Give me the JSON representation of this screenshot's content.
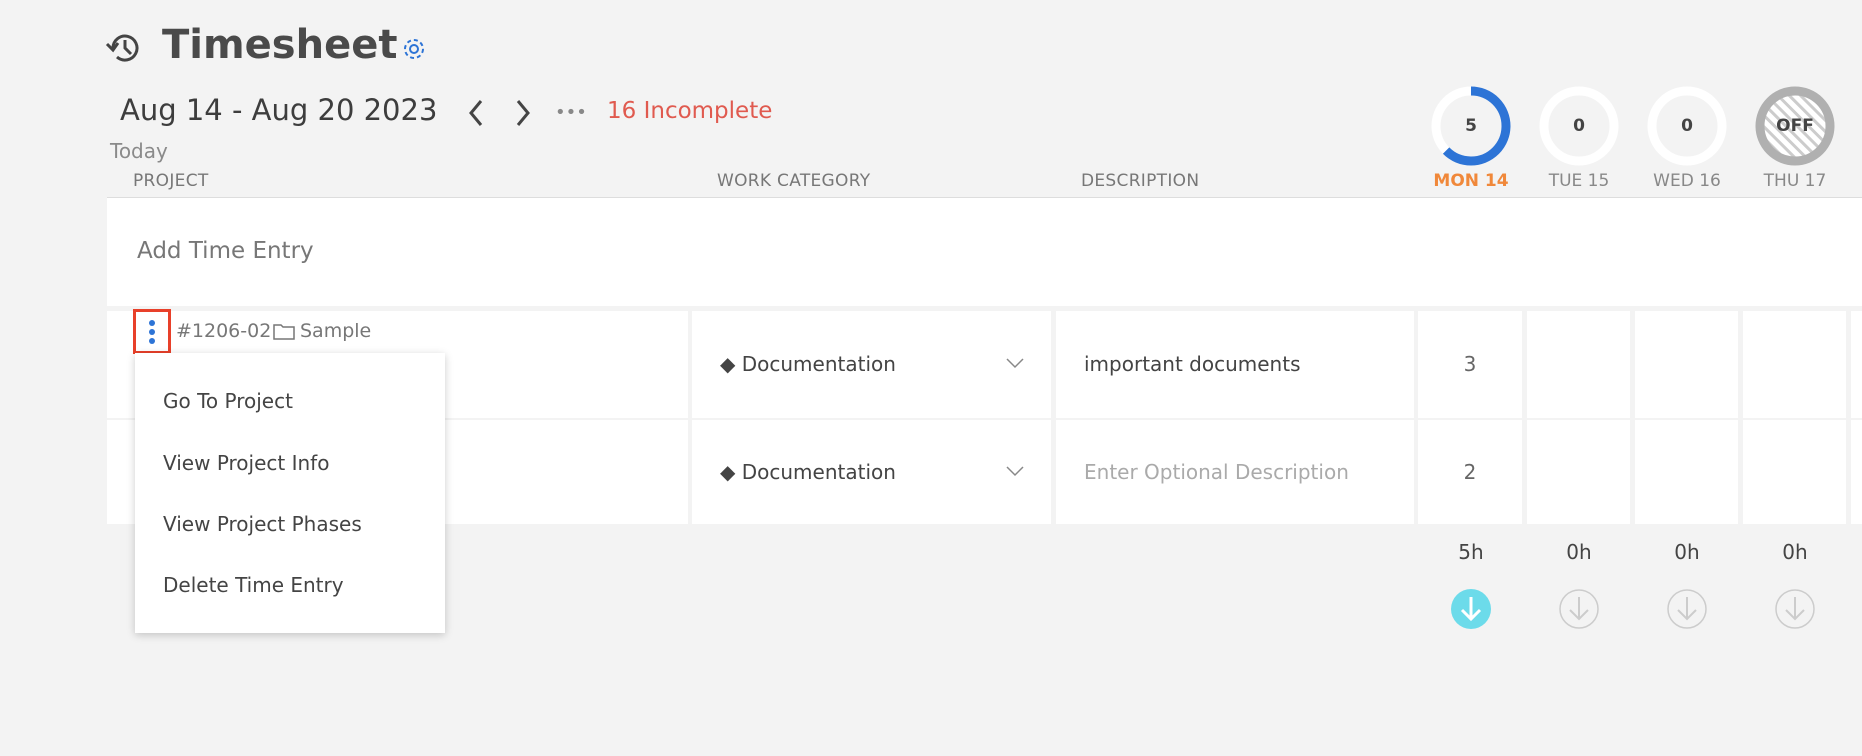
{
  "header": {
    "title": "Timesheet",
    "date_range": "Aug 14 - Aug 20 2023",
    "incomplete": "16 Incomplete",
    "today": "Today",
    "more": "•••"
  },
  "columns": {
    "project": "PROJECT",
    "work_category": "WORK CATEGORY",
    "description": "DESCRIPTION"
  },
  "days": [
    {
      "label": "MON 14",
      "total": "5",
      "progress": 0.625,
      "active": true,
      "hours": "5h"
    },
    {
      "label": "TUE 15",
      "total": "0",
      "progress": 0,
      "active": false,
      "hours": "0h"
    },
    {
      "label": "WED 16",
      "total": "0",
      "progress": 0,
      "active": false,
      "hours": "0h"
    },
    {
      "label": "THU 17",
      "total": "OFF",
      "progress": 0,
      "off": true,
      "hours": "0h"
    }
  ],
  "add_entry": "Add Time Entry",
  "rows": [
    {
      "project_id": "#1206-02",
      "project_name": "Sample",
      "category": "Documentation",
      "description": "important documents",
      "mon": "3"
    },
    {
      "category": "Documentation",
      "description_placeholder": "Enter Optional Description",
      "mon": "2"
    }
  ],
  "menu": {
    "items": [
      "Go To Project",
      "View Project Info",
      "View Project Phases",
      "Delete Time Entry"
    ]
  },
  "colors": {
    "accent": "#2d74d6",
    "today": "#f0883a",
    "incomplete": "#e05a4f",
    "download_active": "#6cdbea",
    "highlight": "#e8402a"
  }
}
